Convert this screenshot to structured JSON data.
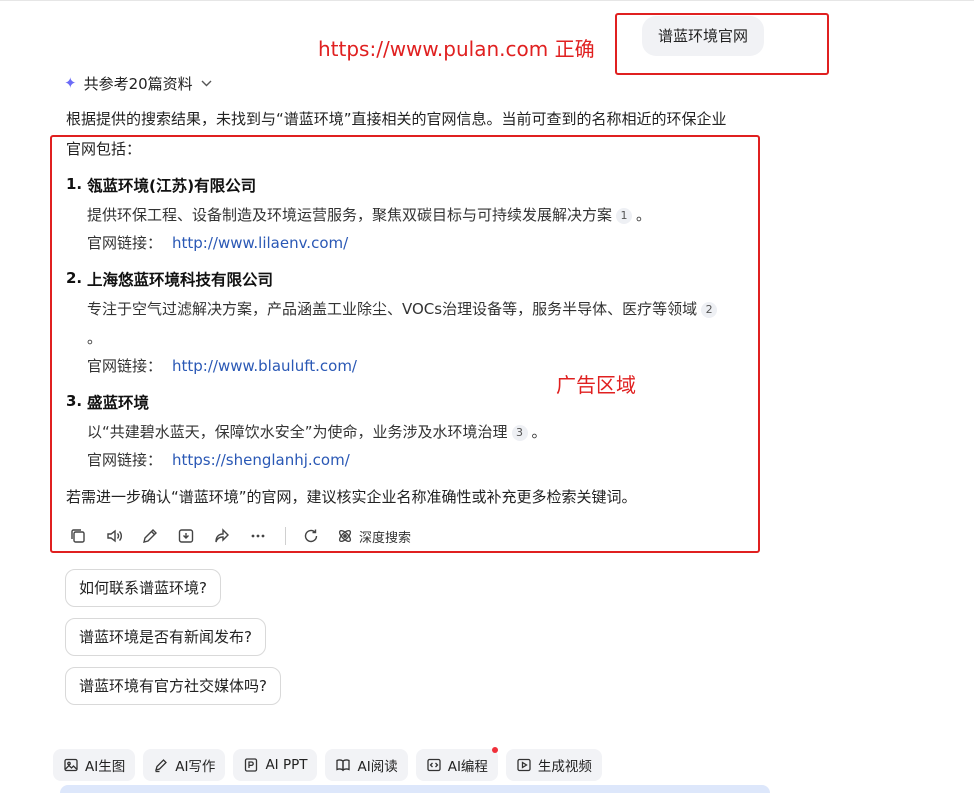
{
  "user_query": "谱蓝环境官网",
  "annotations": {
    "url_note": "https://www.pulan.com 正确",
    "ad_note": "广告区域",
    "color": "#e02020"
  },
  "references_label": "共参考20篇资料",
  "answer": {
    "intro_line1": "根据提供的搜索结果，未找到与“谱蓝环境”直接相关的官网信息。当前可查到的名称相近的环保企业",
    "intro_line2": "官网包括：",
    "link_prefix": "官网链接：",
    "items": [
      {
        "num": "1.",
        "name": "瓴蓝环境(江苏)有限公司",
        "desc": "提供环保工程、设备制造及环境运营服务，聚焦双碳目标与可持续发展解决方案",
        "desc2": "",
        "cite": "1",
        "tail": "。",
        "url": "http://www.lilaenv.com/"
      },
      {
        "num": "2.",
        "name": "上海悠蓝环境科技有限公司",
        "desc": "专注于空气过滤解决方案，产品涵盖工业除尘、VOCs治理设备等，服务半导体、医疗等领域",
        "desc2": "。",
        "cite": "2",
        "tail": "",
        "url": "http://www.blauluft.com/"
      },
      {
        "num": "3.",
        "name": "盛蓝环境",
        "desc": "以“共建碧水蓝天，保障饮水安全”为使命，业务涉及水环境治理",
        "desc2": "",
        "cite": "3",
        "tail": "。",
        "url": "https://shenglanhj.com/"
      }
    ],
    "outro": "若需进一步确认“谱蓝环境”的官网，建议核实企业名称准确性或补充更多检索关键词。"
  },
  "actions": {
    "icons": [
      "copy-icon",
      "speaker-icon",
      "edit-icon",
      "save-icon",
      "share-icon",
      "more-icon",
      "regenerate-icon",
      "deep-search-icon"
    ],
    "deep_search_label": "深度搜索"
  },
  "suggestions": [
    "如何联系谱蓝环境?",
    "谱蓝环境是否有新闻发布?",
    "谱蓝环境有官方社交媒体吗?"
  ],
  "tools": [
    {
      "label": "AI生图",
      "icon": "image-icon"
    },
    {
      "label": "AI写作",
      "icon": "pen-icon"
    },
    {
      "label": "AI PPT",
      "icon": "ppt-icon"
    },
    {
      "label": "AI阅读",
      "icon": "book-icon"
    },
    {
      "label": "AI编程",
      "icon": "code-icon",
      "badge": true
    },
    {
      "label": "生成视频",
      "icon": "video-icon"
    }
  ],
  "colors": {
    "link": "#2a58b5",
    "accent": "#6b6bf7",
    "badge": "#f0303a"
  }
}
